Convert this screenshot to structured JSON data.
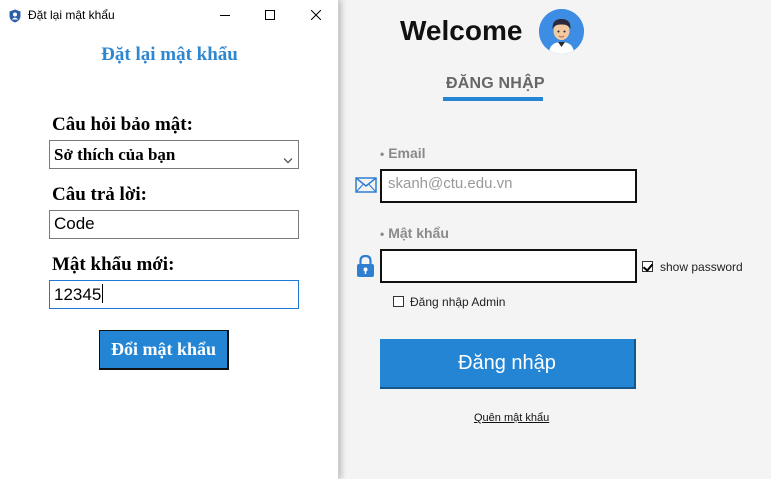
{
  "login": {
    "welcome": "Welcome",
    "tab_label": "ĐĂNG NHẬP",
    "email_label": "Email",
    "email_value": "skanh@ctu.edu.vn",
    "password_label": "Mật khẩu",
    "password_value": "",
    "show_password_label": "show password",
    "show_password_checked": true,
    "admin_label": "Đăng nhập Admin",
    "admin_checked": false,
    "login_button": "Đăng nhập",
    "forgot_link": "Quên mật khẩu",
    "accent_color": "#2385d4"
  },
  "dialog": {
    "window_title": "Đặt lại mật khẩu",
    "heading": "Đặt lại mật khẩu",
    "question_label": "Câu hỏi bảo mật:",
    "question_selected": "Sở thích của bạn",
    "answer_label": "Câu trả lời:",
    "answer_value": "Code",
    "new_password_label": "Mật khẩu mới:",
    "new_password_value": "12345",
    "change_button": "Đổi mật khẩu",
    "icons": {
      "app": "shield-person-icon",
      "minimize": "minimize-icon",
      "maximize": "maximize-icon",
      "close": "close-icon",
      "dropdown": "chevron-down-icon"
    }
  }
}
